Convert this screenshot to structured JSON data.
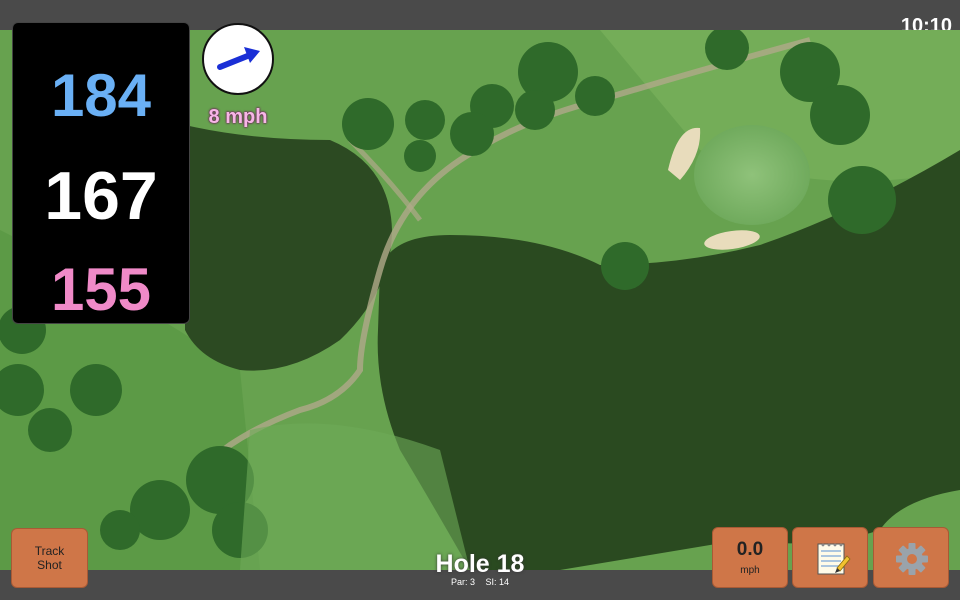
{
  "status": {
    "time": "10:10"
  },
  "yardages": {
    "back": "184",
    "middle": "167",
    "front": "155"
  },
  "wind": {
    "speed": "8 mph",
    "arrow_color": "#1a2fd6"
  },
  "hole": {
    "title": "Hole 18",
    "par": "Par: 3",
    "stroke_index": "SI: 14"
  },
  "buttons": {
    "track_shot_line1": "Track",
    "track_shot_line2": "Shot",
    "speed_value": "0.0",
    "speed_unit": "mph",
    "notes_icon": "notepad-icon",
    "settings_icon": "gear-icon"
  },
  "colors": {
    "back_yardage": "#6ab0f5",
    "middle_yardage": "#ffffff",
    "front_yardage": "#f08ac8",
    "button": "#cf7648"
  }
}
